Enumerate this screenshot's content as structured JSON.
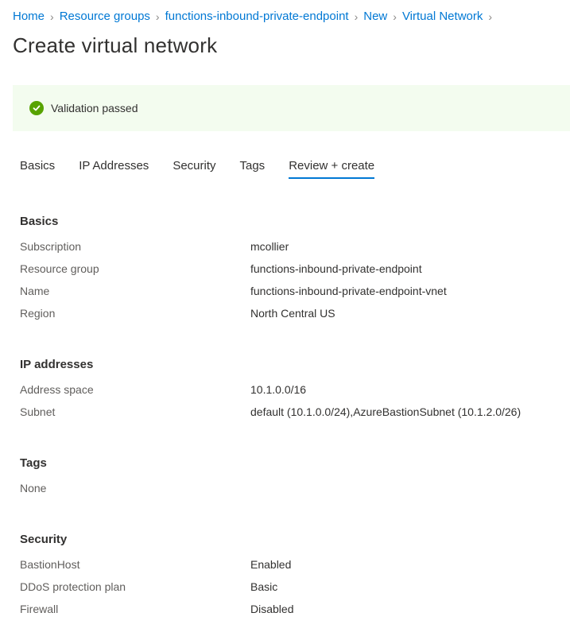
{
  "breadcrumb": [
    {
      "label": "Home"
    },
    {
      "label": "Resource groups"
    },
    {
      "label": "functions-inbound-private-endpoint"
    },
    {
      "label": "New"
    },
    {
      "label": "Virtual Network"
    }
  ],
  "breadcrumb_separator": ">",
  "page_title": "Create virtual network",
  "banner": {
    "status": "success",
    "icon": "check-circle-icon",
    "text": "Validation passed",
    "color": "#57a300",
    "background": "#f3fcef"
  },
  "tabs": [
    {
      "label": "Basics",
      "active": false
    },
    {
      "label": "IP Addresses",
      "active": false
    },
    {
      "label": "Security",
      "active": false
    },
    {
      "label": "Tags",
      "active": false
    },
    {
      "label": "Review + create",
      "active": true
    }
  ],
  "accent_color": "#0078d4",
  "sections": {
    "basics": {
      "title": "Basics",
      "rows": [
        {
          "label": "Subscription",
          "value": "mcollier"
        },
        {
          "label": "Resource group",
          "value": "functions-inbound-private-endpoint"
        },
        {
          "label": "Name",
          "value": "functions-inbound-private-endpoint-vnet"
        },
        {
          "label": "Region",
          "value": "North Central US"
        }
      ]
    },
    "ip_addresses": {
      "title": "IP addresses",
      "rows": [
        {
          "label": "Address space",
          "value": "10.1.0.0/16"
        },
        {
          "label": "Subnet",
          "value": "default (10.1.0.0/24),AzureBastionSubnet (10.1.2.0/26)"
        }
      ]
    },
    "tags": {
      "title": "Tags",
      "text": "None"
    },
    "security": {
      "title": "Security",
      "rows": [
        {
          "label": "BastionHost",
          "value": "Enabled"
        },
        {
          "label": "DDoS protection plan",
          "value": "Basic"
        },
        {
          "label": "Firewall",
          "value": "Disabled"
        }
      ]
    }
  }
}
